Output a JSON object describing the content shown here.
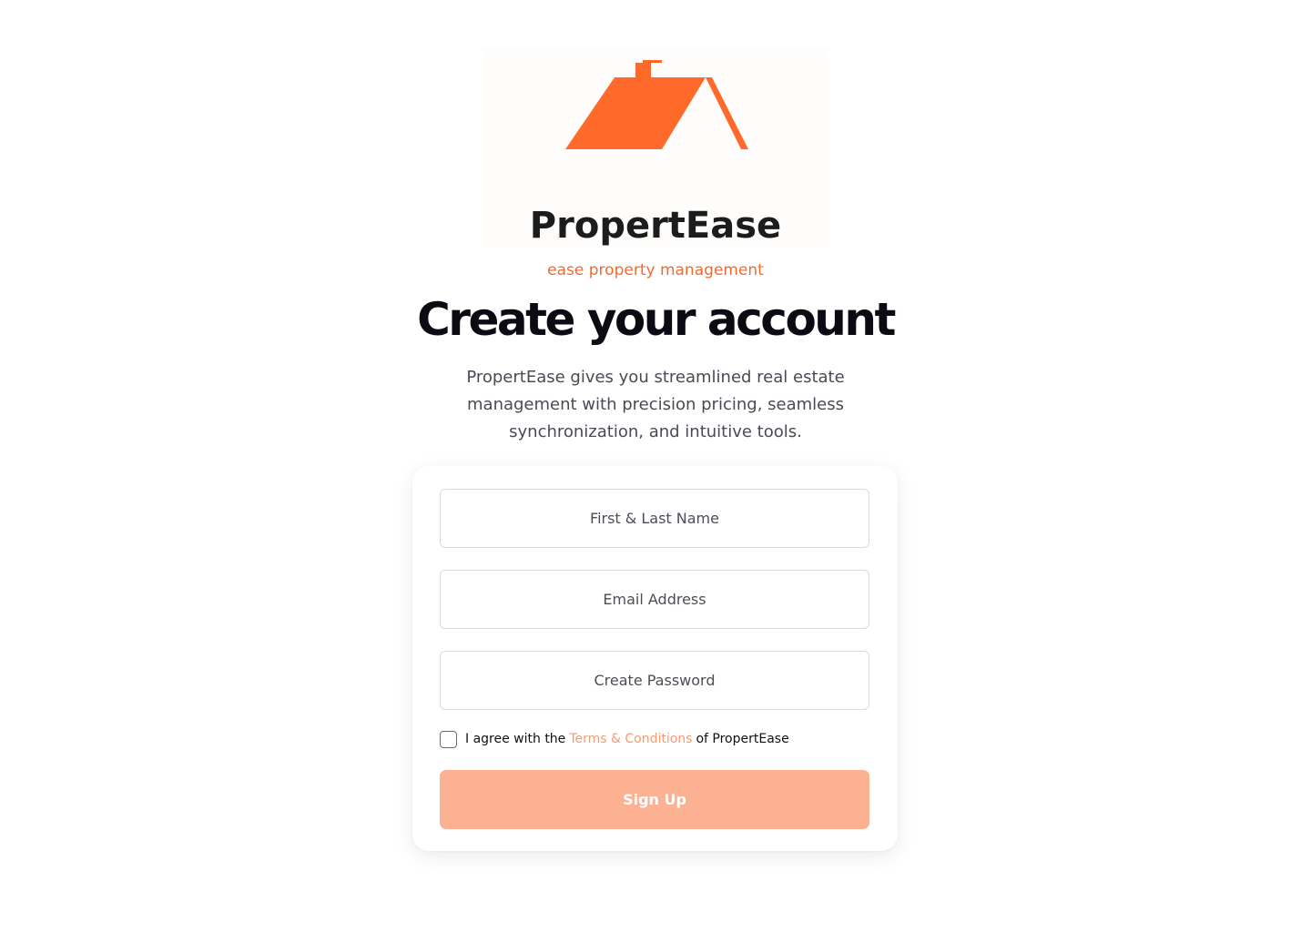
{
  "brand": {
    "name": "PropertEase",
    "tagline": "ease property management",
    "accent_color": "#FF6A2B",
    "icon": "house-roof-logo"
  },
  "heading": {
    "title": "Create your account",
    "subtitle": "PropertEase gives you streamlined real estate management with precision pricing, seamless synchronization, and intuitive tools."
  },
  "form": {
    "name_placeholder": "First & Last Name",
    "name_value": "",
    "email_placeholder": "Email Address",
    "email_value": "",
    "password_placeholder": "Create Password",
    "password_value": "",
    "agree_prefix": "I agree with the",
    "terms_link": "Terms & Conditions",
    "agree_suffix": "of PropertEase",
    "agree_checked": false,
    "submit_label": "Sign Up",
    "submit_color": "#FDB193"
  }
}
